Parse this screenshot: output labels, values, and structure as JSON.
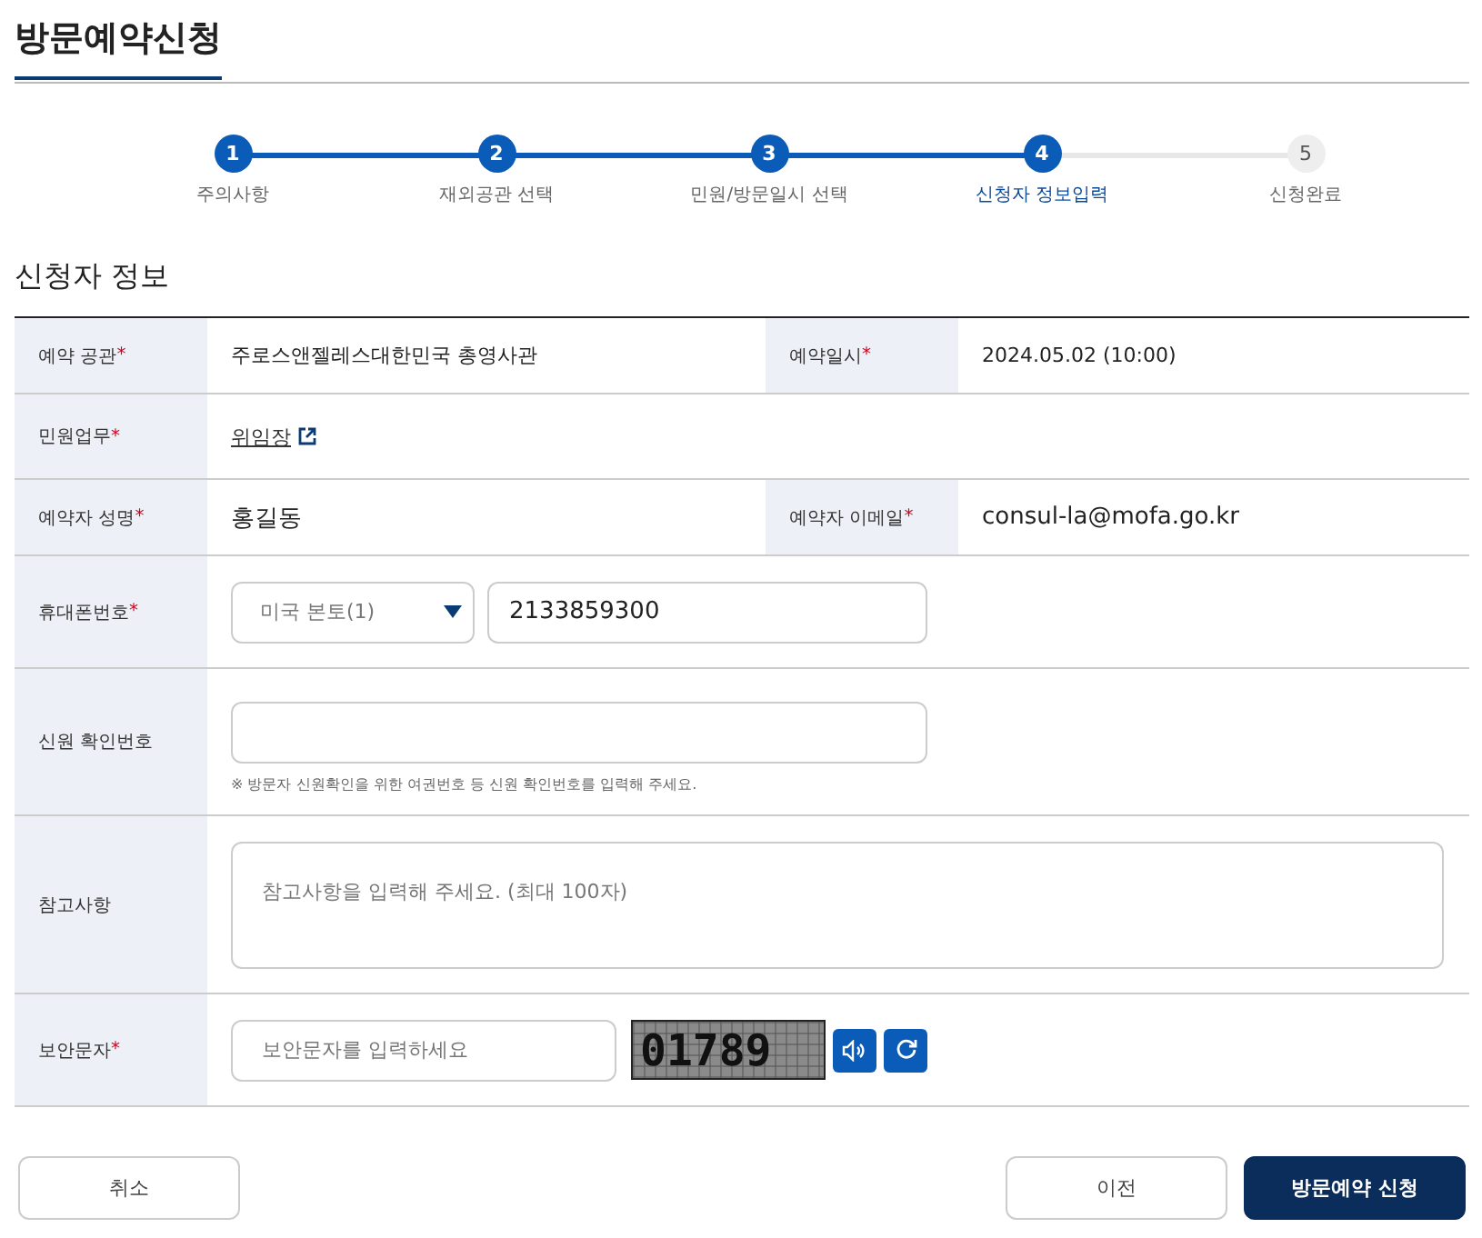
{
  "page_title": "방문예약신청",
  "steps": [
    {
      "number": "1",
      "label": "주의사항",
      "done": true,
      "selected": false
    },
    {
      "number": "2",
      "label": "재외공관 선택",
      "done": true,
      "selected": false
    },
    {
      "number": "3",
      "label": "민원/방문일시 선택",
      "done": true,
      "selected": false
    },
    {
      "number": "4",
      "label": "신청자 정보입력",
      "done": true,
      "selected": true
    },
    {
      "number": "5",
      "label": "신청완료",
      "done": false,
      "selected": false
    }
  ],
  "section_title": "신청자 정보",
  "form_rows": [
    {
      "kind": "pair",
      "cells": [
        {
          "label": "예약 공관",
          "required_mark": "*",
          "value": "주로스앤젤레스대한민국 총영사관"
        },
        {
          "label": "예약일시",
          "required_mark": "*",
          "value": "2024.05.02 (10:00)"
        }
      ]
    },
    {
      "kind": "link",
      "label": "민원업무",
      "required_mark": "*",
      "link": "위임장"
    },
    {
      "kind": "pair",
      "cells": [
        {
          "label": "예약자 성명",
          "required_mark": "*",
          "value": "홍길동"
        },
        {
          "label": "예약자 이메일",
          "required_mark": "*",
          "value": "consul-la@mofa.go.kr"
        }
      ]
    },
    {
      "kind": "phone",
      "label": "휴대폰번호",
      "required_mark": "*",
      "select": "미국 본토(1)",
      "value": "2133859300"
    },
    {
      "kind": "text",
      "label": "신원 확인번호",
      "note": "※ 방문자 신원확인을 위한 여권번호 등 신원 확인번호를 입력해 주세요."
    },
    {
      "kind": "textarea",
      "label": "참고사항",
      "placeholder": "참고사항을 입력해 주세요. (최대 100자)"
    },
    {
      "kind": "captcha",
      "label": "보안문자",
      "required_mark": "*",
      "placeholder": "보안문자를 입력하세요",
      "captcha": "01789"
    }
  ],
  "buttons": {
    "cancel": "취소",
    "previous": "이전",
    "submit": "방문예약 신청"
  }
}
